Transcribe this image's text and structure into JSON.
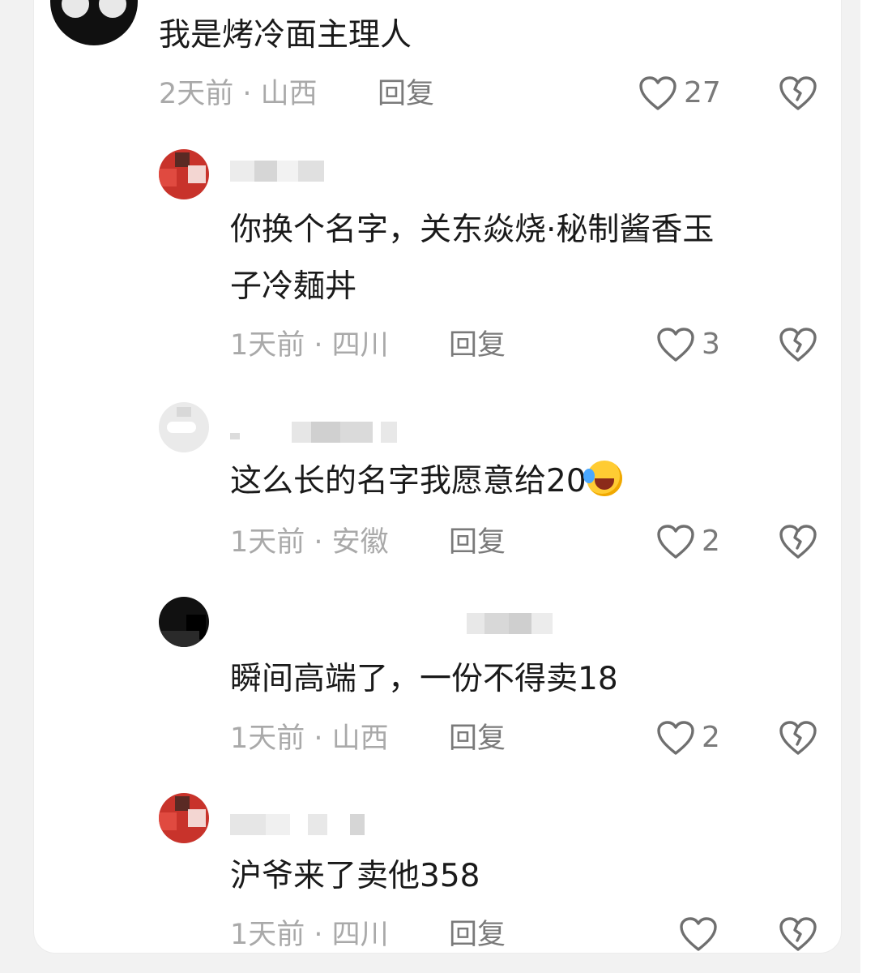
{
  "comments": [
    {
      "text": "我是烤冷面主理人",
      "meta": "2天前 · 山西",
      "reply": "回复",
      "likes": "27",
      "avatar": "black-avatar"
    },
    {
      "text_line1": "你换个名字，关东焱烧·秘制酱香玉",
      "text_line2": "子冷麺丼",
      "meta": "1天前 · 四川",
      "reply": "回复",
      "likes": "3",
      "avatar": "red-avatar"
    },
    {
      "text": "这么长的名字我愿意给20",
      "emoji": "laughing-crying-emoji",
      "meta": "1天前 · 安徽",
      "reply": "回复",
      "likes": "2",
      "avatar": "grey-avatar"
    },
    {
      "text": "瞬间高端了，一份不得卖18",
      "meta": "1天前 · 山西",
      "reply": "回复",
      "likes": "2",
      "avatar": "black-avatar"
    },
    {
      "text": "沪爷来了卖他358",
      "meta": "1天前 · 四川",
      "reply": "回复",
      "likes": "",
      "avatar": "red-avatar"
    }
  ],
  "icons": {
    "like": "heart-outline-icon",
    "dislike": "broken-heart-icon"
  },
  "colors": {
    "background": "#f2f2f2",
    "card": "#ffffff",
    "text": "#1a1a1a",
    "meta": "#a9a9a9",
    "action": "#7a7a7a"
  }
}
